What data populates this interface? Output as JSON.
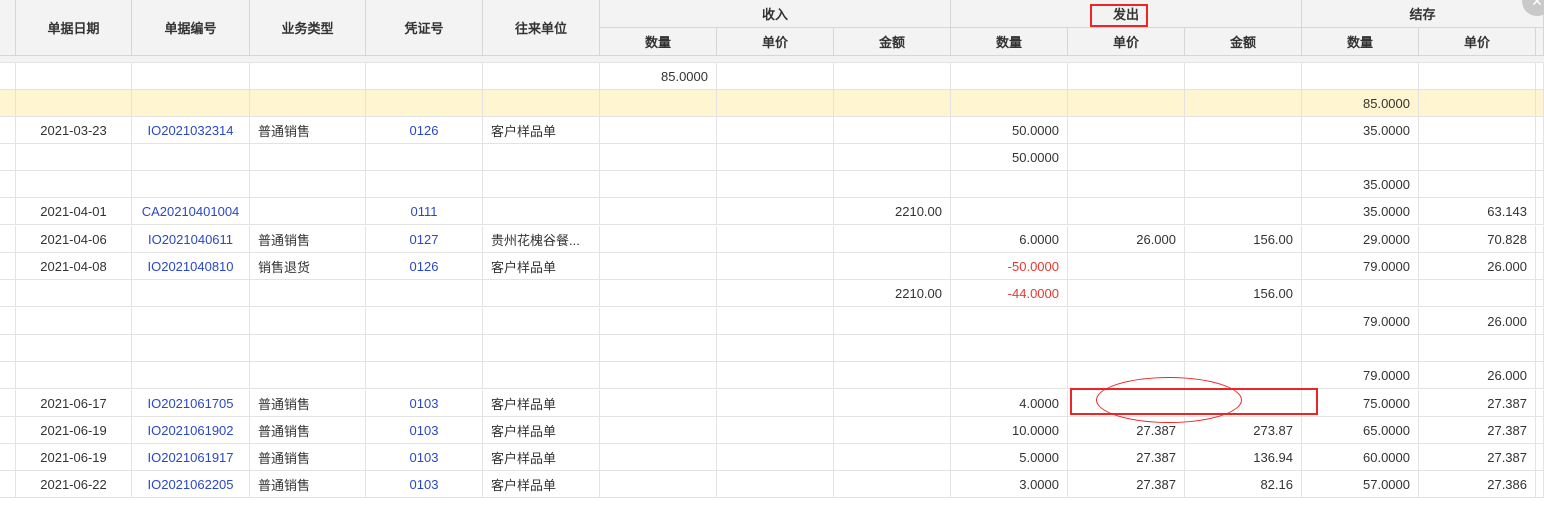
{
  "header": {
    "col_date": "单据日期",
    "col_doc_no": "单据编号",
    "col_biz_type": "业务类型",
    "col_voucher": "凭证号",
    "col_partner": "往来单位",
    "group_income": "收入",
    "group_issue": "发出",
    "group_balance": "结存",
    "sub_qty": "数量",
    "sub_price": "单价",
    "sub_amount": "金额"
  },
  "rows": [
    {
      "date": "",
      "doc_no": "",
      "biz_type": "",
      "voucher": "",
      "partner": "",
      "in_qty": "85.0000",
      "in_price": "",
      "in_amount": "",
      "out_qty": "",
      "out_price": "",
      "out_amount": "",
      "bal_qty": "",
      "bal_price": ""
    },
    {
      "date": "",
      "doc_no": "",
      "biz_type": "",
      "voucher": "",
      "partner": "",
      "in_qty": "",
      "in_price": "",
      "in_amount": "",
      "out_qty": "",
      "out_price": "",
      "out_amount": "",
      "bal_qty": "85.0000",
      "bal_price": ""
    },
    {
      "date": "2021-03-23",
      "doc_no": "IO2021032314",
      "biz_type": "普通销售",
      "voucher": "0126",
      "partner": "客户样品单",
      "in_qty": "",
      "in_price": "",
      "in_amount": "",
      "out_qty": "50.0000",
      "out_price": "",
      "out_amount": "",
      "bal_qty": "35.0000",
      "bal_price": ""
    },
    {
      "date": "",
      "doc_no": "",
      "biz_type": "",
      "voucher": "",
      "partner": "",
      "in_qty": "",
      "in_price": "",
      "in_amount": "",
      "out_qty": "50.0000",
      "out_price": "",
      "out_amount": "",
      "bal_qty": "",
      "bal_price": ""
    },
    {
      "date": "",
      "doc_no": "",
      "biz_type": "",
      "voucher": "",
      "partner": "",
      "in_qty": "",
      "in_price": "",
      "in_amount": "",
      "out_qty": "",
      "out_price": "",
      "out_amount": "",
      "bal_qty": "35.0000",
      "bal_price": ""
    },
    {
      "date": "2021-04-01",
      "doc_no": "CA20210401004",
      "biz_type": "",
      "voucher": "0111",
      "partner": "",
      "in_qty": "",
      "in_price": "",
      "in_amount": "2210.00",
      "out_qty": "",
      "out_price": "",
      "out_amount": "",
      "bal_qty": "35.0000",
      "bal_price": "63.143"
    },
    {
      "date": "2021-04-06",
      "doc_no": "IO2021040611",
      "biz_type": "普通销售",
      "voucher": "0127",
      "partner": "贵州花槐谷餐...",
      "in_qty": "",
      "in_price": "",
      "in_amount": "",
      "out_qty": "6.0000",
      "out_price": "26.000",
      "out_amount": "156.00",
      "bal_qty": "29.0000",
      "bal_price": "70.828"
    },
    {
      "date": "2021-04-08",
      "doc_no": "IO2021040810",
      "biz_type": "销售退货",
      "voucher": "0126",
      "partner": "客户样品单",
      "in_qty": "",
      "in_price": "",
      "in_amount": "",
      "out_qty": "-50.0000",
      "out_price": "",
      "out_amount": "",
      "bal_qty": "79.0000",
      "bal_price": "26.000"
    },
    {
      "date": "",
      "doc_no": "",
      "biz_type": "",
      "voucher": "",
      "partner": "",
      "in_qty": "",
      "in_price": "",
      "in_amount": "2210.00",
      "out_qty": "-44.0000",
      "out_price": "",
      "out_amount": "156.00",
      "bal_qty": "",
      "bal_price": ""
    },
    {
      "date": "",
      "doc_no": "",
      "biz_type": "",
      "voucher": "",
      "partner": "",
      "in_qty": "",
      "in_price": "",
      "in_amount": "",
      "out_qty": "",
      "out_price": "",
      "out_amount": "",
      "bal_qty": "79.0000",
      "bal_price": "26.000"
    },
    {
      "date": "",
      "doc_no": "",
      "biz_type": "",
      "voucher": "",
      "partner": "",
      "in_qty": "",
      "in_price": "",
      "in_amount": "",
      "out_qty": "",
      "out_price": "",
      "out_amount": "",
      "bal_qty": "",
      "bal_price": ""
    },
    {
      "date": "",
      "doc_no": "",
      "biz_type": "",
      "voucher": "",
      "partner": "",
      "in_qty": "",
      "in_price": "",
      "in_amount": "",
      "out_qty": "",
      "out_price": "",
      "out_amount": "",
      "bal_qty": "79.0000",
      "bal_price": "26.000"
    },
    {
      "date": "2021-06-17",
      "doc_no": "IO2021061705",
      "biz_type": "普通销售",
      "voucher": "0103",
      "partner": "客户样品单",
      "in_qty": "",
      "in_price": "",
      "in_amount": "",
      "out_qty": "4.0000",
      "out_price": "",
      "out_amount": "",
      "bal_qty": "75.0000",
      "bal_price": "27.387"
    },
    {
      "date": "2021-06-19",
      "doc_no": "IO2021061902",
      "biz_type": "普通销售",
      "voucher": "0103",
      "partner": "客户样品单",
      "in_qty": "",
      "in_price": "",
      "in_amount": "",
      "out_qty": "10.0000",
      "out_price": "27.387",
      "out_amount": "273.87",
      "bal_qty": "65.0000",
      "bal_price": "27.387"
    },
    {
      "date": "2021-06-19",
      "doc_no": "IO2021061917",
      "biz_type": "普通销售",
      "voucher": "0103",
      "partner": "客户样品单",
      "in_qty": "",
      "in_price": "",
      "in_amount": "",
      "out_qty": "5.0000",
      "out_price": "27.387",
      "out_amount": "136.94",
      "bal_qty": "60.0000",
      "bal_price": "27.387"
    },
    {
      "date": "2021-06-22",
      "doc_no": "IO2021062205",
      "biz_type": "普通销售",
      "voucher": "0103",
      "partner": "客户样品单",
      "in_qty": "",
      "in_price": "",
      "in_amount": "",
      "out_qty": "3.0000",
      "out_price": "27.387",
      "out_amount": "82.16",
      "bal_qty": "57.0000",
      "bal_price": "27.386"
    }
  ],
  "colors": {
    "header_bg": "#f3f3f3",
    "highlight_row_bg": "#fff5d0",
    "link": "#2a48c6",
    "negative": "#e8392f",
    "annotation": "#ee2525"
  },
  "icons": {
    "corner": "close-icon"
  }
}
